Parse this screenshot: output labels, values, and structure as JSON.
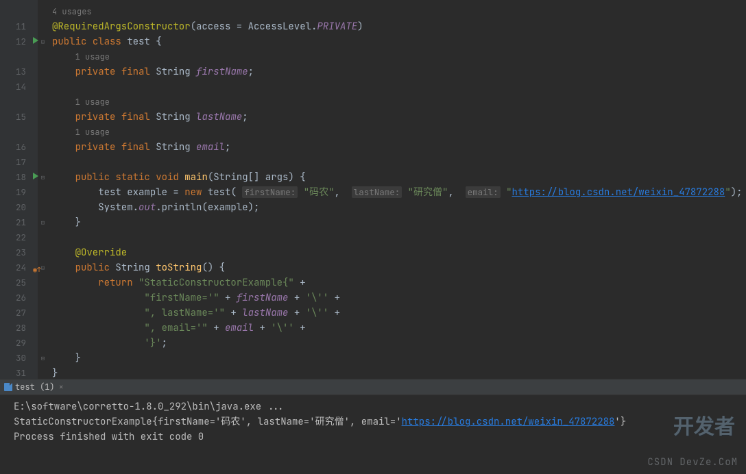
{
  "editor": {
    "usage4": "4 usages",
    "usage1a": "1 usage",
    "usage1b": "1 usage",
    "usage1c": "1 usage",
    "line_numbers": [
      11,
      12,
      13,
      14,
      15,
      16,
      17,
      18,
      19,
      20,
      21,
      22,
      23,
      24,
      25,
      26,
      27,
      28,
      29,
      30,
      31
    ],
    "tokens": {
      "annot_constr": "@RequiredArgsConstructor",
      "access_eq": "(access = AccessLevel.",
      "private_italic": "PRIVATE",
      "rparen": ")",
      "public": "public",
      "class": "class",
      "classname": "test",
      "lbrace": "{",
      "private": "private",
      "final": "final",
      "string": "String",
      "firstName": "firstName",
      "lastName": "lastName",
      "email": "email",
      "semi": ";",
      "static": "static",
      "void": "void",
      "main": "main",
      "main_args": "(String[] args) {",
      "test_type": "test",
      "example": "example",
      "eq": " = ",
      "new": "new",
      "test_ctor": "test",
      "lparen2": "(",
      "hint_fn": "firstName:",
      "str_fn": "\"码农\"",
      "comma": ", ",
      "hint_ln": "lastName:",
      "str_ln": "\"研究僧\"",
      "hint_em": "email:",
      "str_em_q": "\"",
      "str_em_url": "https://blog.csdn.net/weixin_47872288",
      "rparen_semi": ");",
      "system": "System.",
      "out": "out",
      "println": ".println(",
      "example2": "example",
      "rparen_semi2": ");",
      "rbrace": "}",
      "override": "@Override",
      "toString": "toString",
      "toString_sig": "() {",
      "return": "return",
      "str_static": "\"StaticConstructorExample{\"",
      "plus": " +",
      "str_fn2": "\"firstName='\"",
      "fn_field": "firstName",
      "sq": "'\\''",
      "str_ln2": "\", lastName='\"",
      "ln_field": "lastName",
      "str_em2": "\", email='\"",
      "em_field": "email",
      "str_close": "'}'"
    }
  },
  "tab": {
    "label": "test (1)",
    "close": "×"
  },
  "console": {
    "line1": "E:\\software\\corretto-1.8.0_292\\bin\\java.exe ...",
    "line2_pre": "StaticConstructorExample{firstName='码农', lastName='研究僧', email='",
    "line2_url": "https://blog.csdn.net/weixin_47872288",
    "line2_post": "'}",
    "line3": "",
    "line4": "Process finished with exit code 0"
  },
  "watermarks": {
    "w1": "开发者",
    "w2": "CSDN DevZe.CoM"
  }
}
